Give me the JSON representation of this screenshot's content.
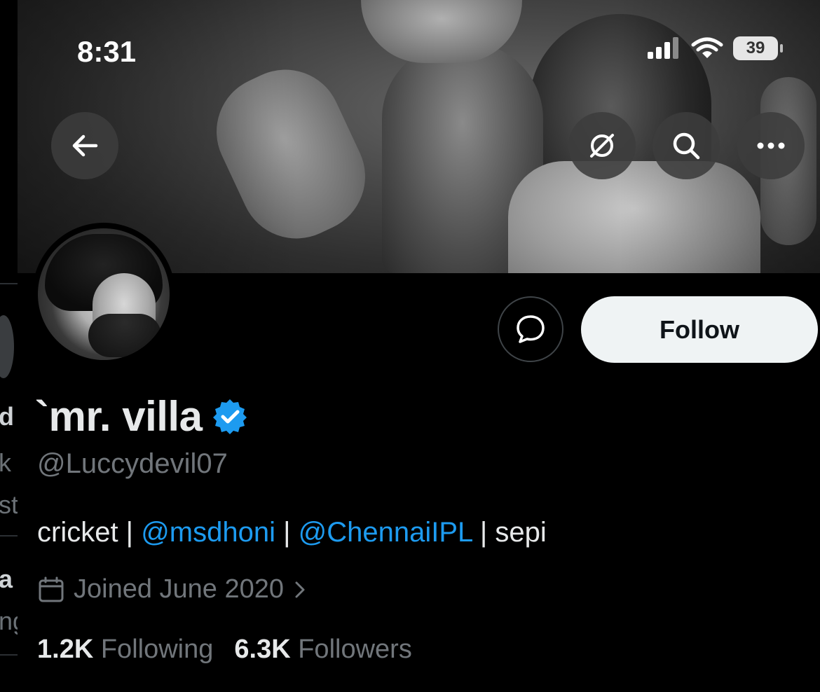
{
  "status_bar": {
    "time": "8:31",
    "battery": "39"
  },
  "profile": {
    "display_name": "`mr. villa",
    "handle": "@Luccydevil07",
    "bio": {
      "prefix": "cricket | ",
      "mention1": "@msdhoni",
      "sep1": " | ",
      "mention2": "@ChennaiIPL",
      "suffix": " | sepi"
    },
    "joined": "Joined June 2020",
    "following_count": "1.2K",
    "following_label": "Following",
    "followers_count": "6.3K",
    "followers_label": "Followers"
  },
  "actions": {
    "follow_label": "Follow"
  },
  "left_partial": [
    "d",
    "k",
    "st",
    "a",
    "ng"
  ],
  "colors": {
    "link": "#1d9bf0",
    "verified": "#1d9bf0",
    "background": "#000000",
    "muted": "#71767b"
  }
}
